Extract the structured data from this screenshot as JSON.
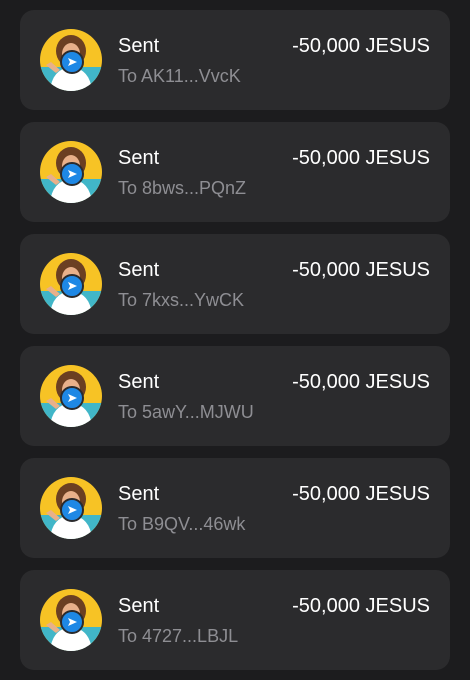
{
  "colors": {
    "background": "#1c1c1e",
    "card": "#2b2b2d",
    "primary_text": "#ffffff",
    "secondary_text": "#8e8e93",
    "badge": "#1e88e5",
    "avatar_bg": "#f7c325"
  },
  "transactions": [
    {
      "status": "Sent",
      "recipient": "To AK11...VvcK",
      "amount": "-50,000 JESUS",
      "icon": "send-arrow-icon"
    },
    {
      "status": "Sent",
      "recipient": "To 8bws...PQnZ",
      "amount": "-50,000 JESUS",
      "icon": "send-arrow-icon"
    },
    {
      "status": "Sent",
      "recipient": "To 7kxs...YwCK",
      "amount": "-50,000 JESUS",
      "icon": "send-arrow-icon"
    },
    {
      "status": "Sent",
      "recipient": "To 5awY...MJWU",
      "amount": "-50,000 JESUS",
      "icon": "send-arrow-icon"
    },
    {
      "status": "Sent",
      "recipient": "To B9QV...46wk",
      "amount": "-50,000 JESUS",
      "icon": "send-arrow-icon"
    },
    {
      "status": "Sent",
      "recipient": "To 4727...LBJL",
      "amount": "-50,000 JESUS",
      "icon": "send-arrow-icon"
    }
  ]
}
